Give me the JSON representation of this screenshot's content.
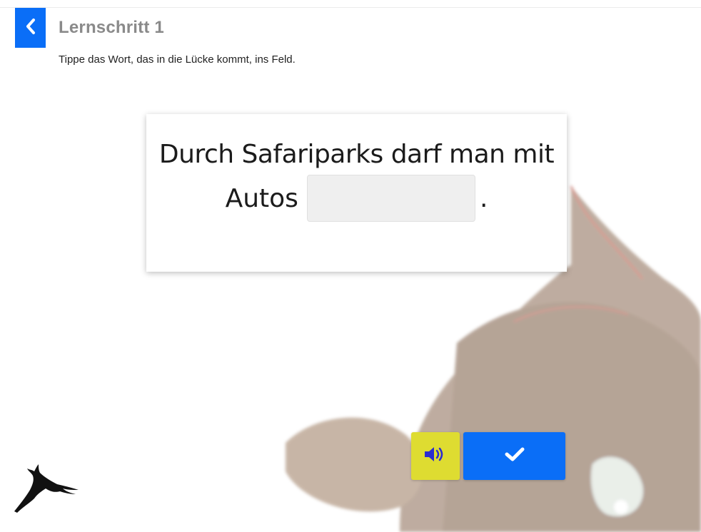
{
  "header": {
    "back_icon": "chevron-left-icon",
    "title": "Lernschritt 1"
  },
  "instruction": "Tippe das Wort, das in die Lücke kommt, ins Feld.",
  "exercise": {
    "sentence_line1": "Durch Safariparks darf man mit",
    "sentence_before_gap": "Autos",
    "sentence_after_gap": ".",
    "gap_value": ""
  },
  "controls": {
    "audio_icon": "speaker-icon",
    "check_icon": "checkmark-icon"
  },
  "colors": {
    "accent_blue": "#0a6ef7",
    "audio_yellow": "#dedc31",
    "title_gray": "#8a8a8a"
  }
}
